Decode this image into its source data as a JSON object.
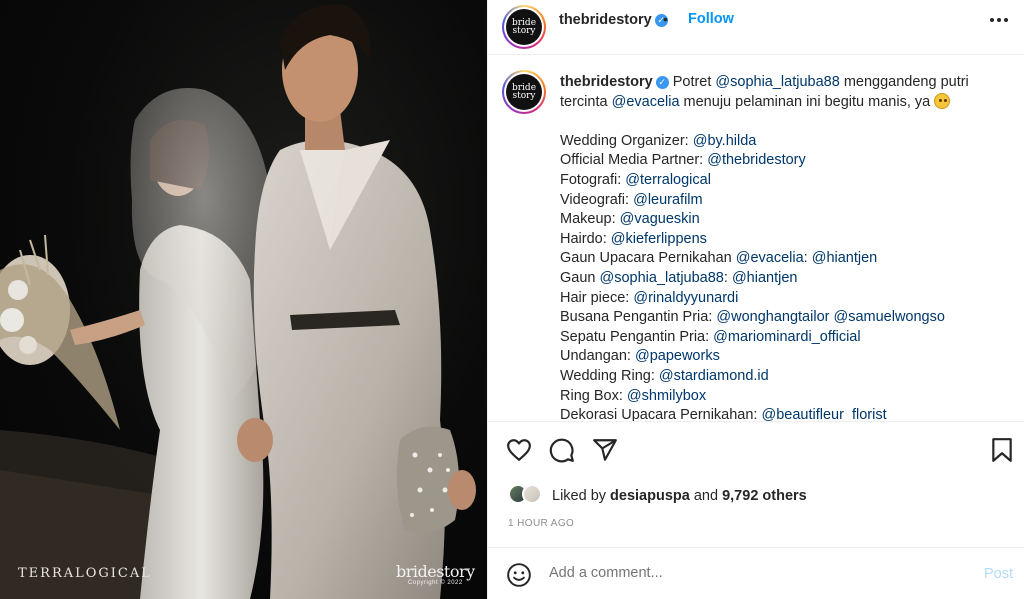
{
  "photo": {
    "watermark_left": "TERRALOGICAL",
    "watermark_brand": "bridestory",
    "watermark_copyright": "Copyright © 2022"
  },
  "header": {
    "username": "thebridestory",
    "avatar_text": "bride story",
    "separator": "•",
    "follow_label": "Follow",
    "more_label": "•••"
  },
  "caption": {
    "username": "thebridestory",
    "lines": [
      [
        {
          "t": "Potret "
        },
        {
          "m": "@sophia_latjuba88"
        },
        {
          "t": " menggandeng putri"
        }
      ],
      [
        {
          "t": "tercinta "
        },
        {
          "m": "@evacelia"
        },
        {
          "t": " menuju pelaminan ini begitu manis, ya "
        }
      ],
      [],
      [
        {
          "t": "Wedding Organizer: "
        },
        {
          "m": "@by.hilda"
        }
      ],
      [
        {
          "t": "Official Media Partner: "
        },
        {
          "m": "@thebridestory"
        }
      ],
      [
        {
          "t": "Fotografi: "
        },
        {
          "m": "@terralogical"
        }
      ],
      [
        {
          "t": "Videografi: "
        },
        {
          "m": "@leurafilm"
        }
      ],
      [
        {
          "t": "Makeup: "
        },
        {
          "m": "@vagueskin"
        }
      ],
      [
        {
          "t": "Hairdo: "
        },
        {
          "m": "@kieferlippens"
        }
      ],
      [
        {
          "t": "Gaun Upacara Pernikahan "
        },
        {
          "m": "@evacelia"
        },
        {
          "t": ": "
        },
        {
          "m": "@hiantjen"
        }
      ],
      [
        {
          "t": "Gaun "
        },
        {
          "m": "@sophia_latjuba88"
        },
        {
          "t": ": "
        },
        {
          "m": "@hiantjen"
        }
      ],
      [
        {
          "t": "Hair piece: "
        },
        {
          "m": "@rinaldyyunardi"
        }
      ],
      [
        {
          "t": "Busana Pengantin Pria: "
        },
        {
          "m": "@wonghangtailor"
        },
        {
          "t": " "
        },
        {
          "m": "@samuelwongso"
        }
      ],
      [
        {
          "t": "Sepatu Pengantin Pria: "
        },
        {
          "m": "@mariominardi_official"
        }
      ],
      [
        {
          "t": "Undangan: "
        },
        {
          "m": "@papeworks"
        }
      ],
      [
        {
          "t": "Wedding Ring: "
        },
        {
          "m": "@stardiamond.id"
        }
      ],
      [
        {
          "t": "Ring Box: "
        },
        {
          "m": "@shmilybox"
        }
      ],
      [
        {
          "t": "Dekorasi Upacara Pernikahan: "
        },
        {
          "m": "@beautifleur_florist"
        }
      ]
    ]
  },
  "actions": {
    "icons": [
      "heart-icon",
      "comment-icon",
      "share-icon",
      "bookmark-icon"
    ],
    "liked_prefix": "Liked by",
    "liked_user": "desiapuspa",
    "liked_and": "and",
    "liked_count": "9,792 others",
    "timestamp": "1 HOUR AGO"
  },
  "comment": {
    "placeholder": "Add a comment...",
    "post_label": "Post"
  },
  "colors": {
    "accent": "#0095f6",
    "mention": "#00376b",
    "post_disabled": "#b3dbff",
    "muted": "#8e8e8e",
    "border": "#efefef"
  }
}
